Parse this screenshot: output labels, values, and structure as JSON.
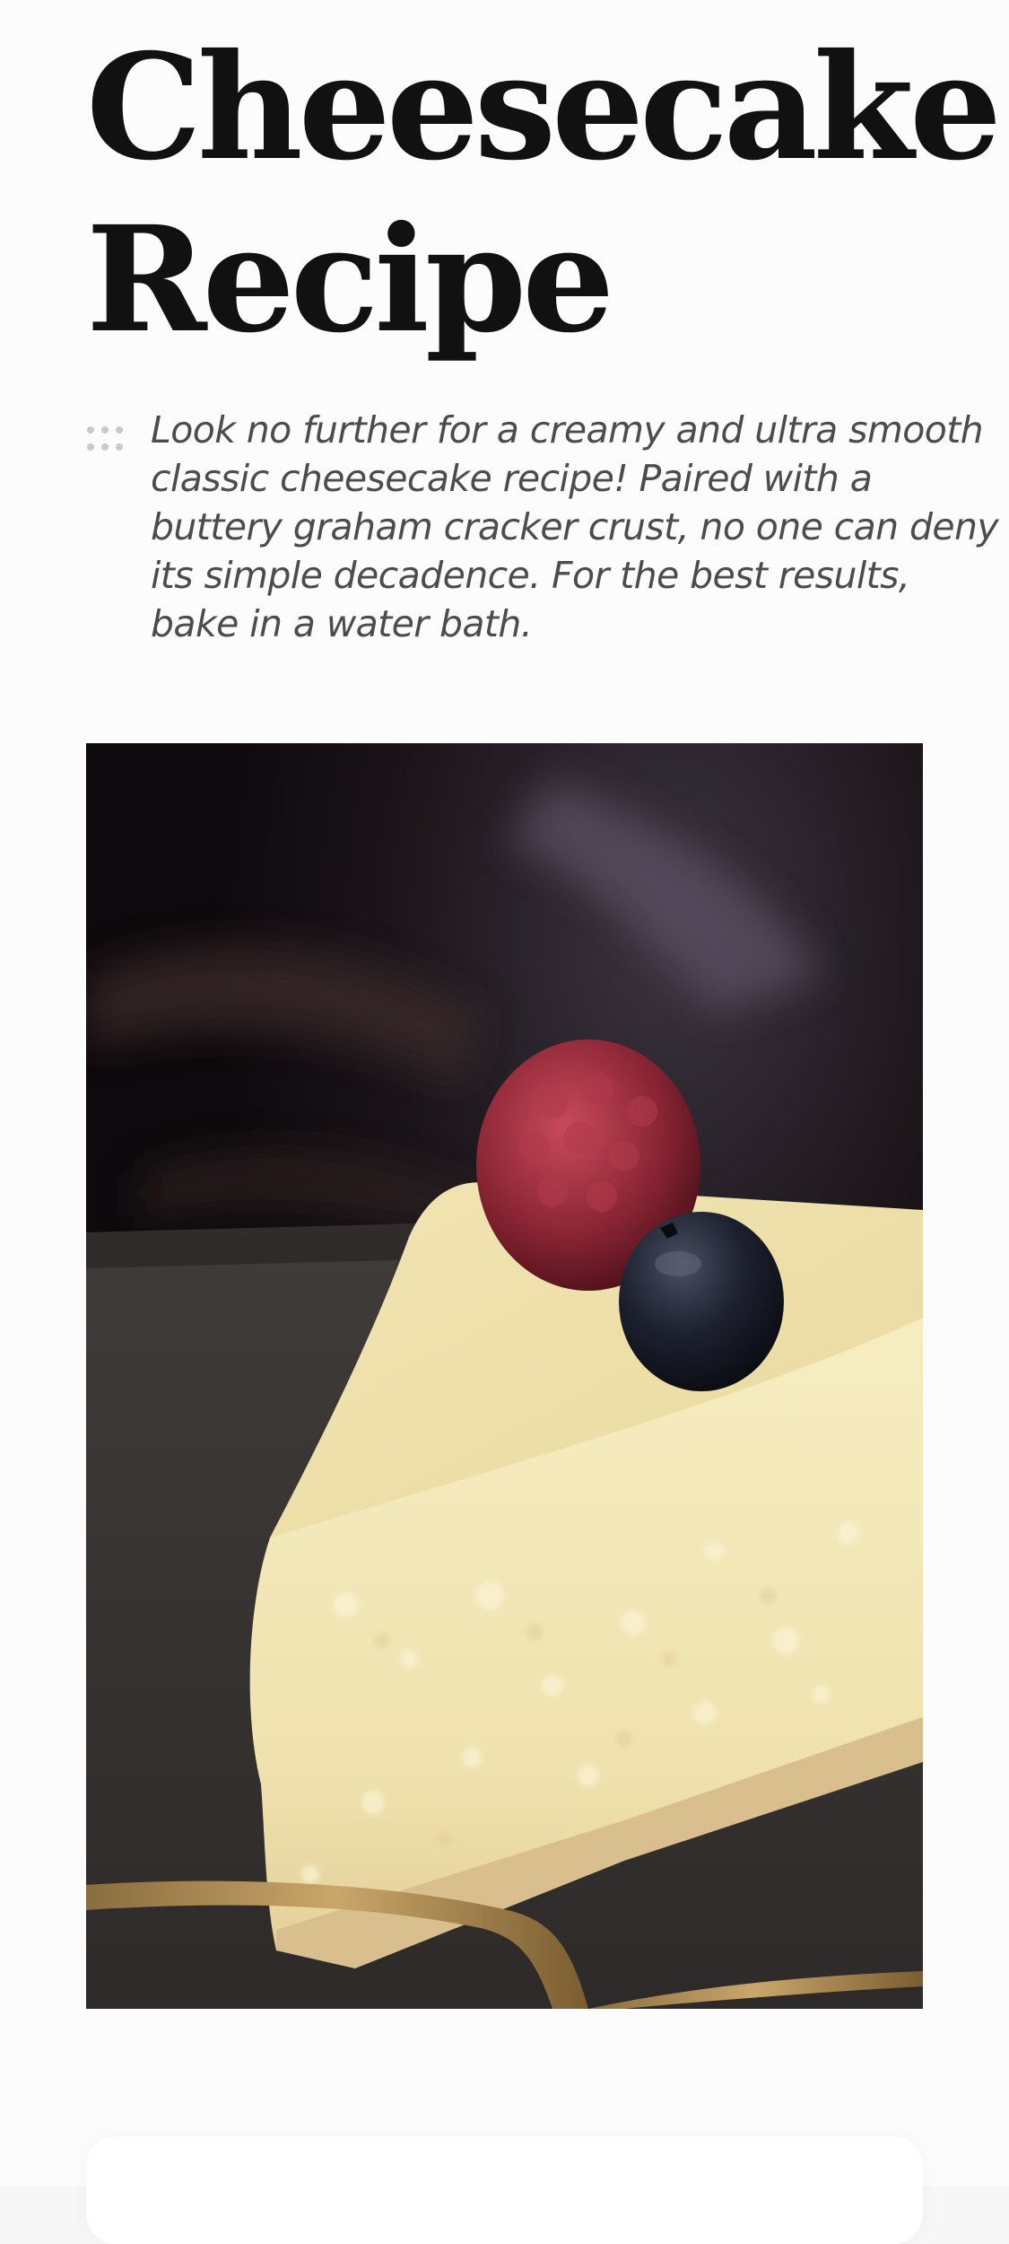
{
  "recipe": {
    "title_line1": "Cheesecake",
    "title_line2": "Recipe",
    "intro": "Look no further for a creamy and ultra smooth classic cheesecake recipe! Paired with a buttery graham cracker crust, no one can deny its simple decadence. For the best results, bake in a water bath.",
    "drag_icon": "drag-handle-icon",
    "photo_subject": "cheesecake-photo"
  },
  "colors": {
    "background": "#fcfcfc",
    "title": "#111111",
    "intro_text": "#4c4c4c",
    "handle": "#c9c9c9"
  }
}
